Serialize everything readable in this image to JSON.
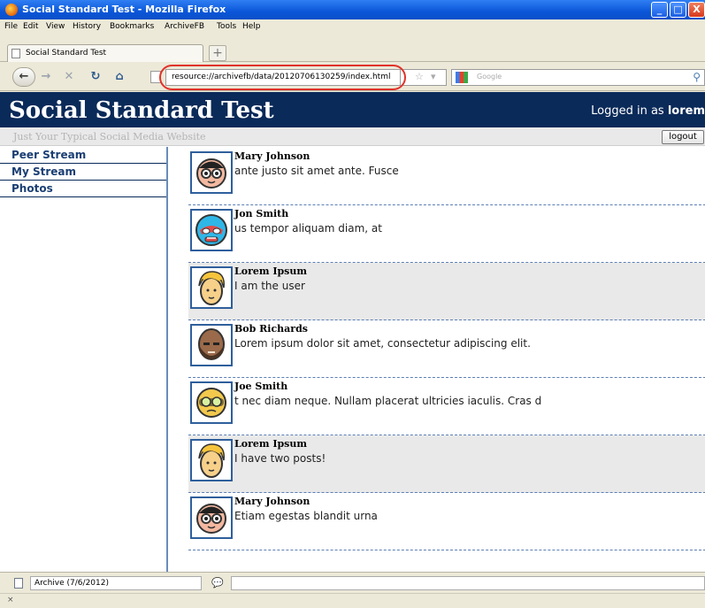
{
  "window": {
    "title": "Social Standard Test - Mozilla Firefox",
    "controls": [
      "_",
      "□",
      "X"
    ]
  },
  "menubar": [
    "File",
    "Edit",
    "View",
    "History",
    "Bookmarks",
    "ArchiveFB",
    "Tools",
    "Help"
  ],
  "tab": {
    "label": "Social Standard Test",
    "new_tab_label": "+"
  },
  "nav": {
    "url": "resource://archivefb/data/20120706130259/index.html",
    "search_placeholder": "Google",
    "url_highlight_color": "#e0322a"
  },
  "site": {
    "title": "Social Standard Test",
    "tagline": "Just Your Typical Social Media Website",
    "logged_in_prefix": "Logged in as",
    "username": "lorem",
    "logout_label": "logout",
    "header_color": "#0a2a59"
  },
  "sidebar": {
    "items": [
      {
        "label": "Peer Stream"
      },
      {
        "label": "My Stream"
      },
      {
        "label": "Photos"
      }
    ]
  },
  "posts": [
    {
      "author": "Mary Johnson",
      "text": "ante justo sit amet ante. Fusce",
      "avatar": "nerd-face",
      "highlighted": false
    },
    {
      "author": "Jon Smith",
      "text": "us tempor aliquam diam, at",
      "avatar": "luchador-mask",
      "highlighted": false
    },
    {
      "author": "Lorem Ipsum",
      "text": "I am the user",
      "avatar": "blonde-face",
      "highlighted": true
    },
    {
      "author": "Bob Richards",
      "text": "Lorem ipsum dolor sit amet, consectetur adipiscing elit.",
      "avatar": "bald-bearded-face",
      "highlighted": false
    },
    {
      "author": "Joe Smith",
      "text": "t nec diam neque. Nullam placerat ultricies iaculis. Cras d",
      "avatar": "goggles-face",
      "highlighted": false
    },
    {
      "author": "Lorem Ipsum",
      "text": "I have two posts!",
      "avatar": "blonde-face",
      "highlighted": true
    },
    {
      "author": "Mary Johnson",
      "text": "Etiam egestas blandit urna",
      "avatar": "nerd-face",
      "highlighted": false
    }
  ],
  "statusbar": {
    "archive_label": "Archive (7/6/2012)"
  },
  "addonbar": {
    "close_label": "×"
  }
}
